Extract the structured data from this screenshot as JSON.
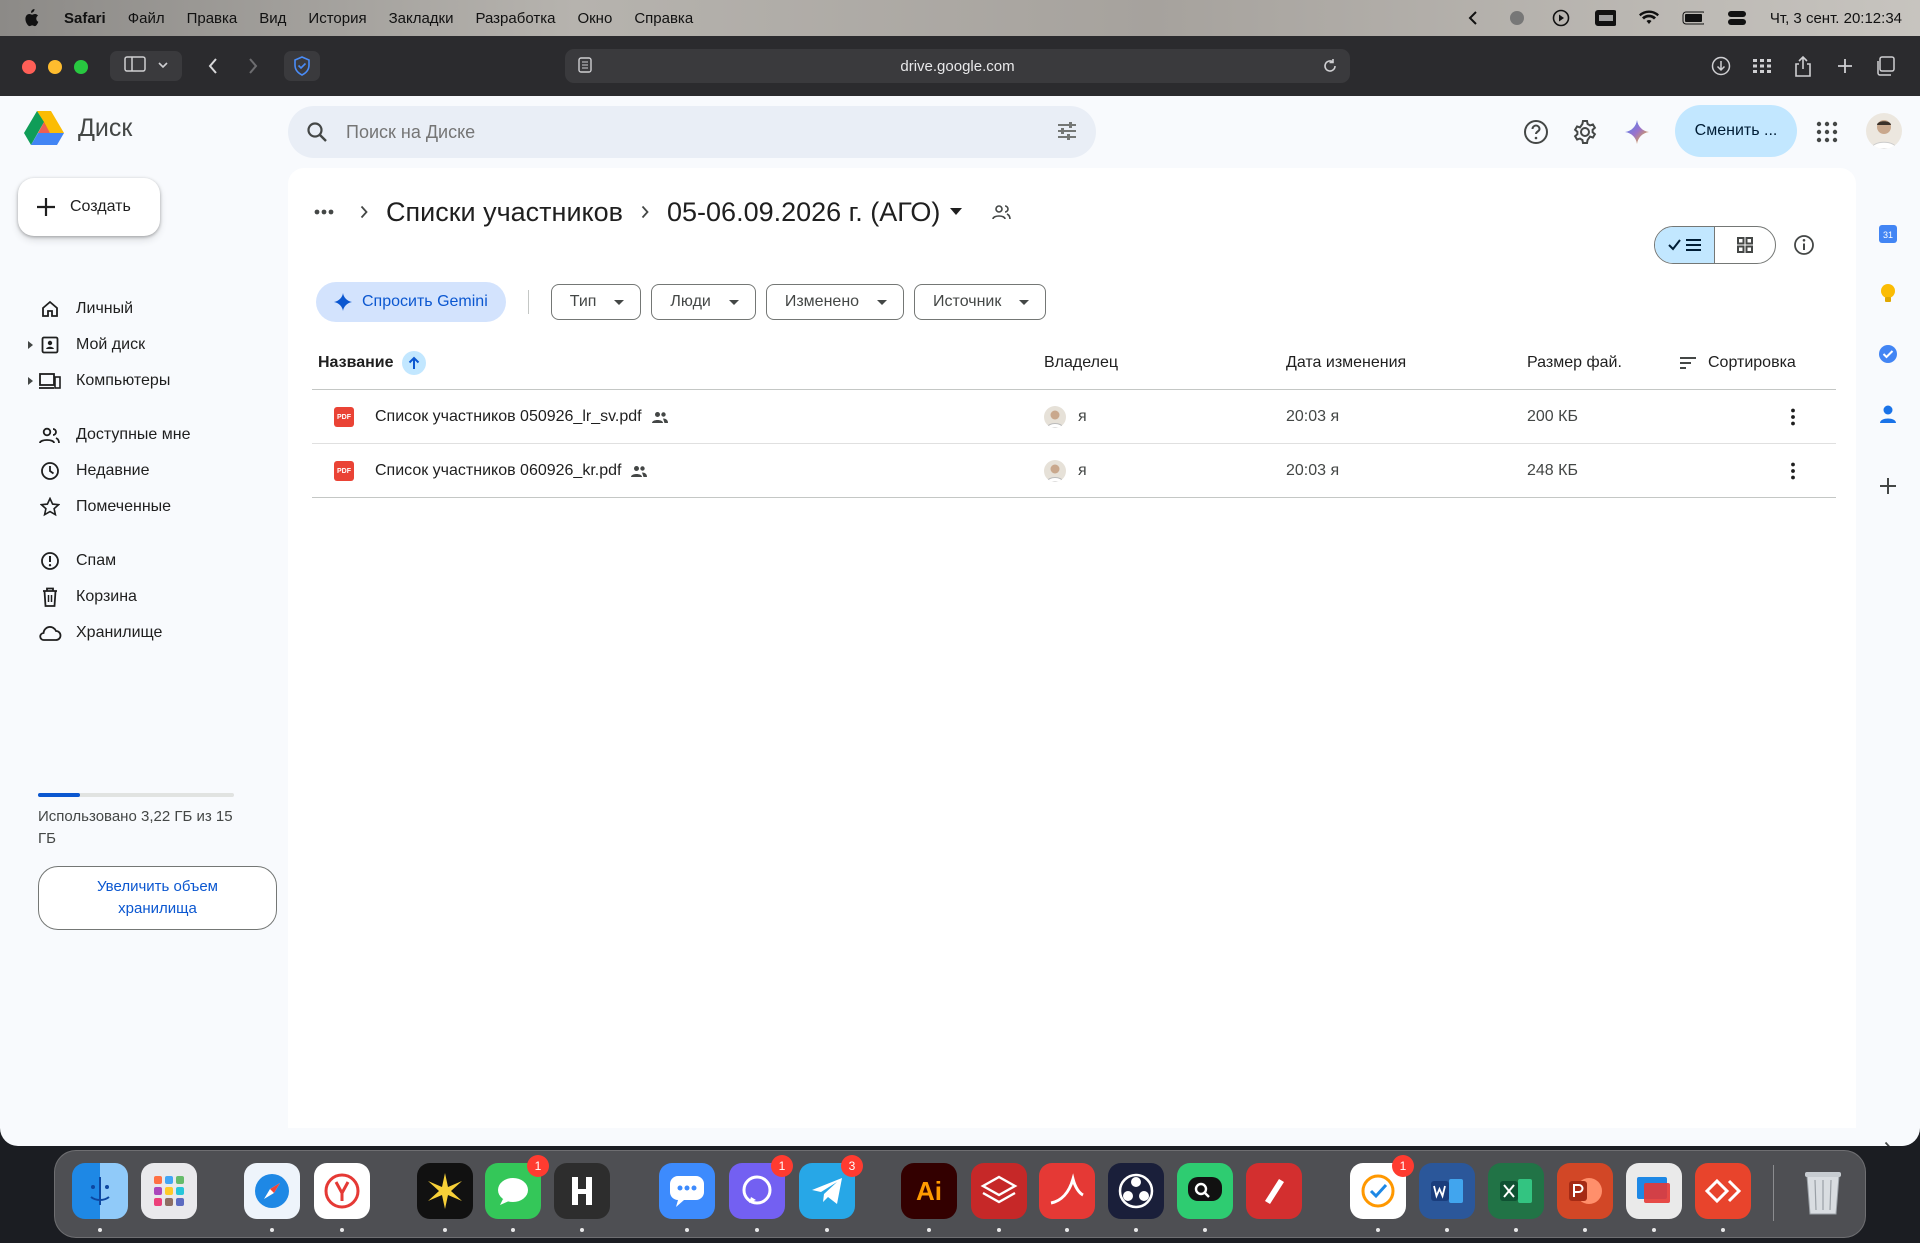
{
  "menubar": {
    "app": "Safari",
    "items": [
      "Файл",
      "Правка",
      "Вид",
      "История",
      "Закладки",
      "Разработка",
      "Окно",
      "Справка"
    ],
    "clock": "Чт, 3 сент.  20:12:34"
  },
  "browser": {
    "url": "drive.google.com"
  },
  "drive": {
    "logo_text": "Диск",
    "search_placeholder": "Поиск на Диске",
    "switch_label": "Сменить ...",
    "create_label": "Создать",
    "nav": [
      {
        "label": "Личный",
        "icon": "home-icon"
      },
      {
        "label": "Мой диск",
        "icon": "my-drive-icon"
      },
      {
        "label": "Компьютеры",
        "icon": "computers-icon"
      },
      {
        "label": "Доступные мне",
        "icon": "shared-icon"
      },
      {
        "label": "Недавние",
        "icon": "clock-icon"
      },
      {
        "label": "Помеченные",
        "icon": "star-icon"
      },
      {
        "label": "Спам",
        "icon": "spam-icon"
      },
      {
        "label": "Корзина",
        "icon": "trash-icon"
      },
      {
        "label": "Хранилище",
        "icon": "cloud-icon"
      }
    ],
    "storage": {
      "used_fraction": 0.215,
      "text": "Использовано 3,22 ГБ из 15 ГБ",
      "upgrade_label": "Увеличить объем хранилища"
    }
  },
  "main": {
    "breadcrumb": {
      "parent": "Списки участников",
      "current": "05-06.09.2026 г. (АГО)"
    },
    "filters": {
      "gemini": "Спросить Gemini",
      "chips": [
        "Тип",
        "Люди",
        "Изменено",
        "Источник"
      ]
    },
    "columns": {
      "name": "Название",
      "owner": "Владелец",
      "modified": "Дата изменения",
      "size": "Размер фай.",
      "sort": "Сортировка"
    },
    "files": [
      {
        "name": "Список участников 050926_lr_sv.pdf",
        "owner": "я",
        "modified": "20:03 я",
        "size": "200 КБ",
        "type_badge": "PDF"
      },
      {
        "name": "Список участников 060926_kr.pdf",
        "owner": "я",
        "modified": "20:03 я",
        "size": "248 КБ",
        "type_badge": "PDF"
      }
    ]
  },
  "dock": {
    "badges": {
      "messages": "1",
      "viber": "1",
      "telegram": "3",
      "reminders": "1"
    },
    "labels": {
      "illustrator": "Ai"
    }
  },
  "colors": {
    "accent": "#0b57d0",
    "chip_selected": "#c2e7ff",
    "gemini_chip": "#d3e3fd",
    "pdf_red": "#ea4335"
  }
}
